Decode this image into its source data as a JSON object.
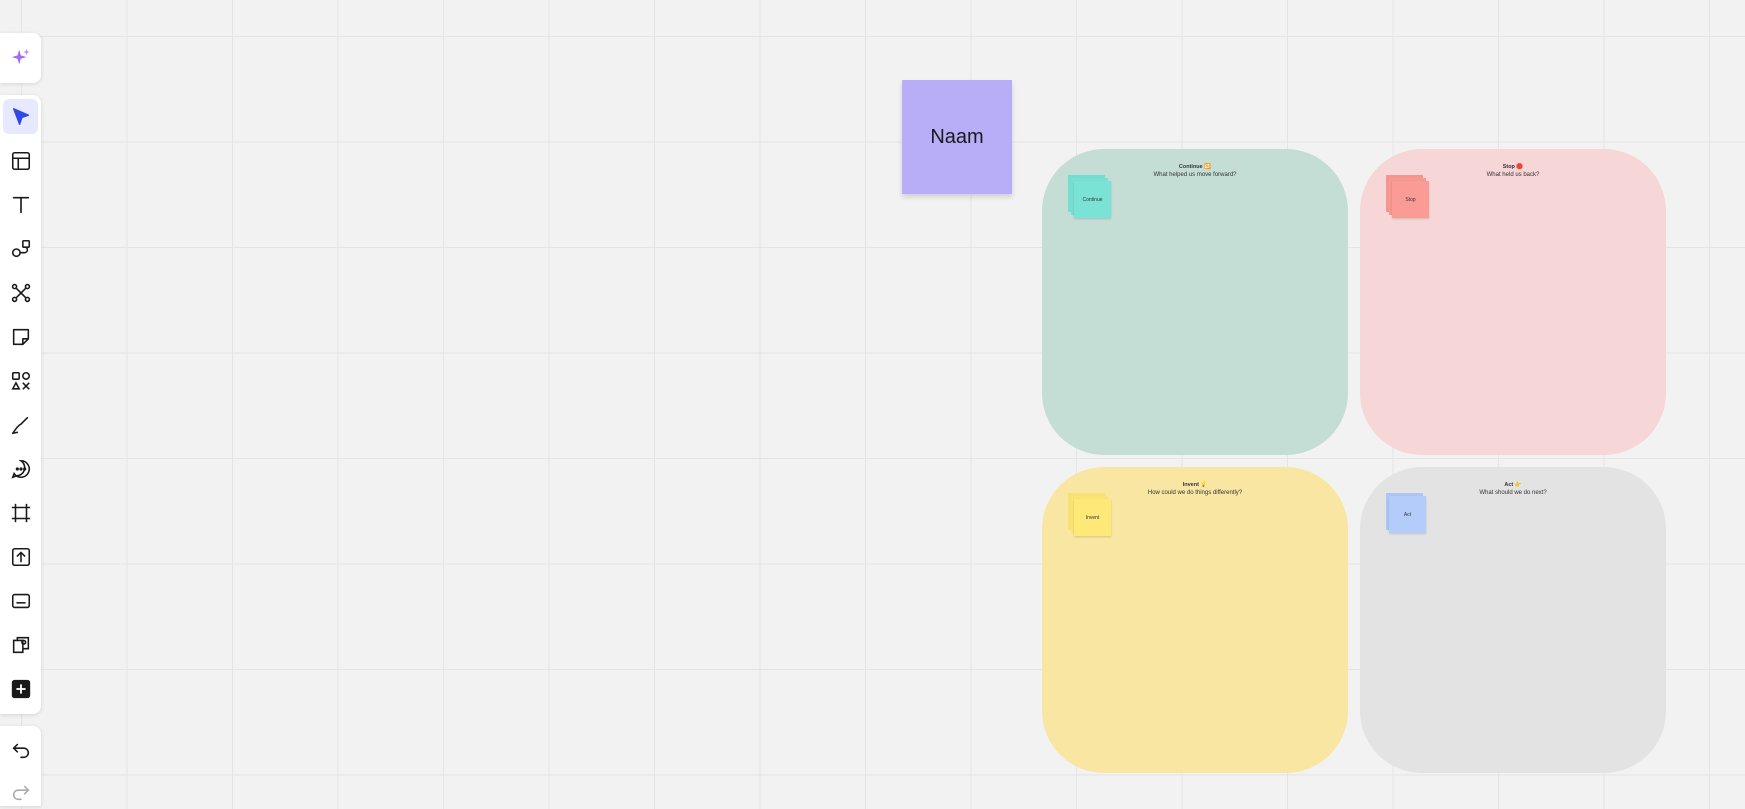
{
  "sticky": {
    "text": "Naam",
    "color": "#b8adf7"
  },
  "quadrants": [
    {
      "title": "Continue 🔁",
      "subtitle": "What helped us move forward?",
      "sticky_label": "Continue",
      "bg": "#c4ded6",
      "sticky_color": "#7be3d6"
    },
    {
      "title": "Stop 🛑",
      "subtitle": "What held us back?",
      "sticky_label": "Stop",
      "bg": "#f6d6d6",
      "sticky_color": "#fb9b96"
    },
    {
      "title": "Invent 💡",
      "subtitle": "How could we do things differently?",
      "sticky_label": "Invent",
      "bg": "#f9e6a2",
      "sticky_color": "#fde878"
    },
    {
      "title": "Act 👉",
      "subtitle": "What should we do next?",
      "sticky_label": "Act",
      "bg": "#e3e3e3",
      "sticky_color": "#b4ccf9"
    }
  ],
  "toolbar": {
    "tools": [
      "ai-sparkle-icon",
      "select-icon",
      "templates-icon",
      "text-icon",
      "shapes-icon",
      "connection-line-icon",
      "sticky-note-icon",
      "more-shapes-icon",
      "pen-icon",
      "comment-icon",
      "frame-icon",
      "upload-icon",
      "card-icon",
      "apps-icon",
      "add-icon"
    ],
    "undo_icon": "undo-icon",
    "redo_icon": "redo-icon",
    "accent": "#4262ff"
  }
}
